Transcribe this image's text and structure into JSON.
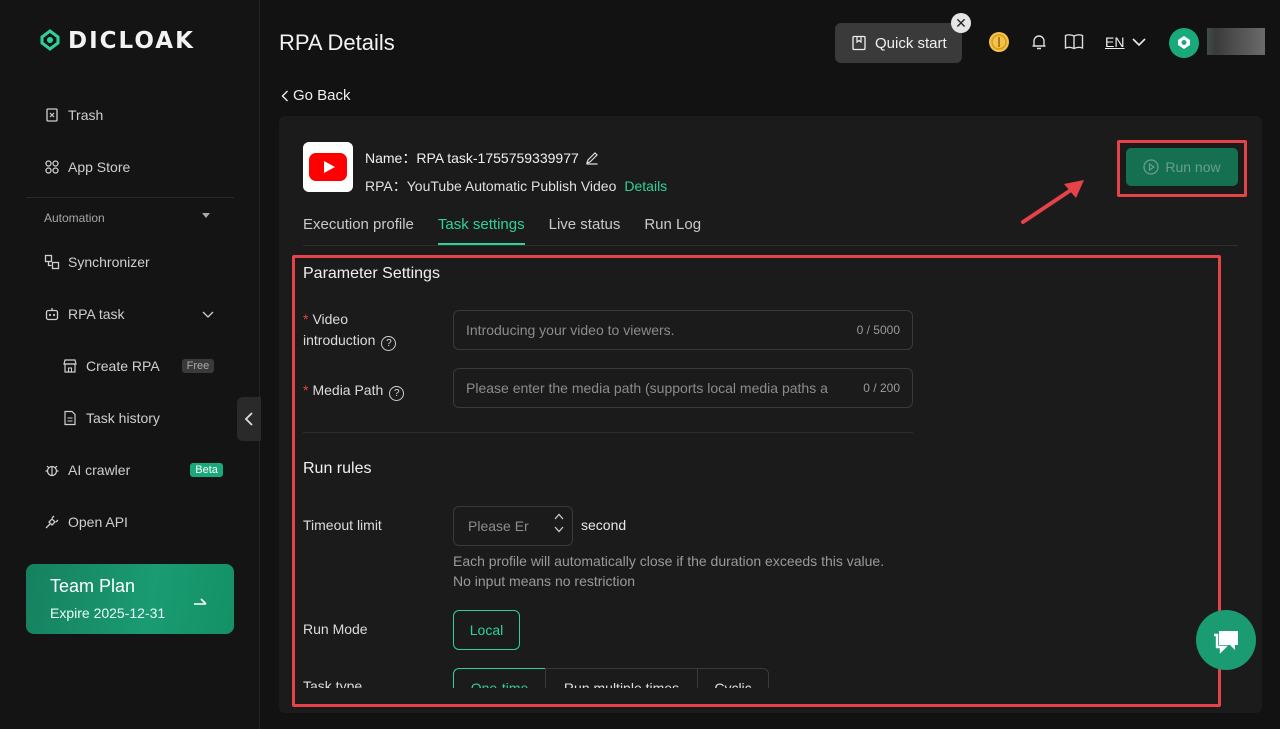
{
  "app": {
    "brand": "DICLOAK",
    "page_title": "RPA Details"
  },
  "sidebar": {
    "trash": "Trash",
    "app_store": "App Store",
    "section_automation": "Automation",
    "synchronizer": "Synchronizer",
    "rpa_task": "RPA task",
    "create_rpa": "Create RPA",
    "create_rpa_badge": "Free",
    "task_history": "Task history",
    "ai_crawler": "AI crawler",
    "ai_crawler_badge": "Beta",
    "open_api": "Open API",
    "plan_title": "Team Plan",
    "plan_expire": "Expire 2025-12-31"
  },
  "header": {
    "quick_start": "Quick start",
    "lang": "EN"
  },
  "nav": {
    "go_back": "Go Back"
  },
  "task": {
    "name": "Name：RPA task-1755759339977",
    "rpa": "RPA：YouTube Automatic Publish Video",
    "details_link": "Details",
    "run_now": "Run now"
  },
  "tabs": [
    "Execution profile",
    "Task settings",
    "Live status",
    "Run Log"
  ],
  "active_tab": "Task settings",
  "params": {
    "section_title": "Parameter Settings",
    "video_intro_label_1": "Video",
    "video_intro_label_2": "introduction",
    "video_intro_placeholder": "Introducing your video to viewers.",
    "video_intro_count": "0 / 5000",
    "media_path_label": "Media Path",
    "media_path_placeholder": "Please enter the media path (supports local media paths a",
    "media_path_count": "0 / 200"
  },
  "rules": {
    "section_title": "Run rules",
    "timeout_label": "Timeout limit",
    "timeout_placeholder": "Please Er",
    "timeout_unit": "second",
    "timeout_hint": "Each profile will automatically close if the duration exceeds this value. No input means no restriction",
    "run_mode_label": "Run Mode",
    "run_mode_value": "Local",
    "task_type_label": "Task type",
    "task_type_options": [
      "One-time",
      "Run multiple times",
      "Cyclic"
    ],
    "task_type_selected": "One-time"
  },
  "colors": {
    "accent": "#2fd19a",
    "highlight_red": "#e5434a",
    "plan_green": "#1a9b72"
  }
}
